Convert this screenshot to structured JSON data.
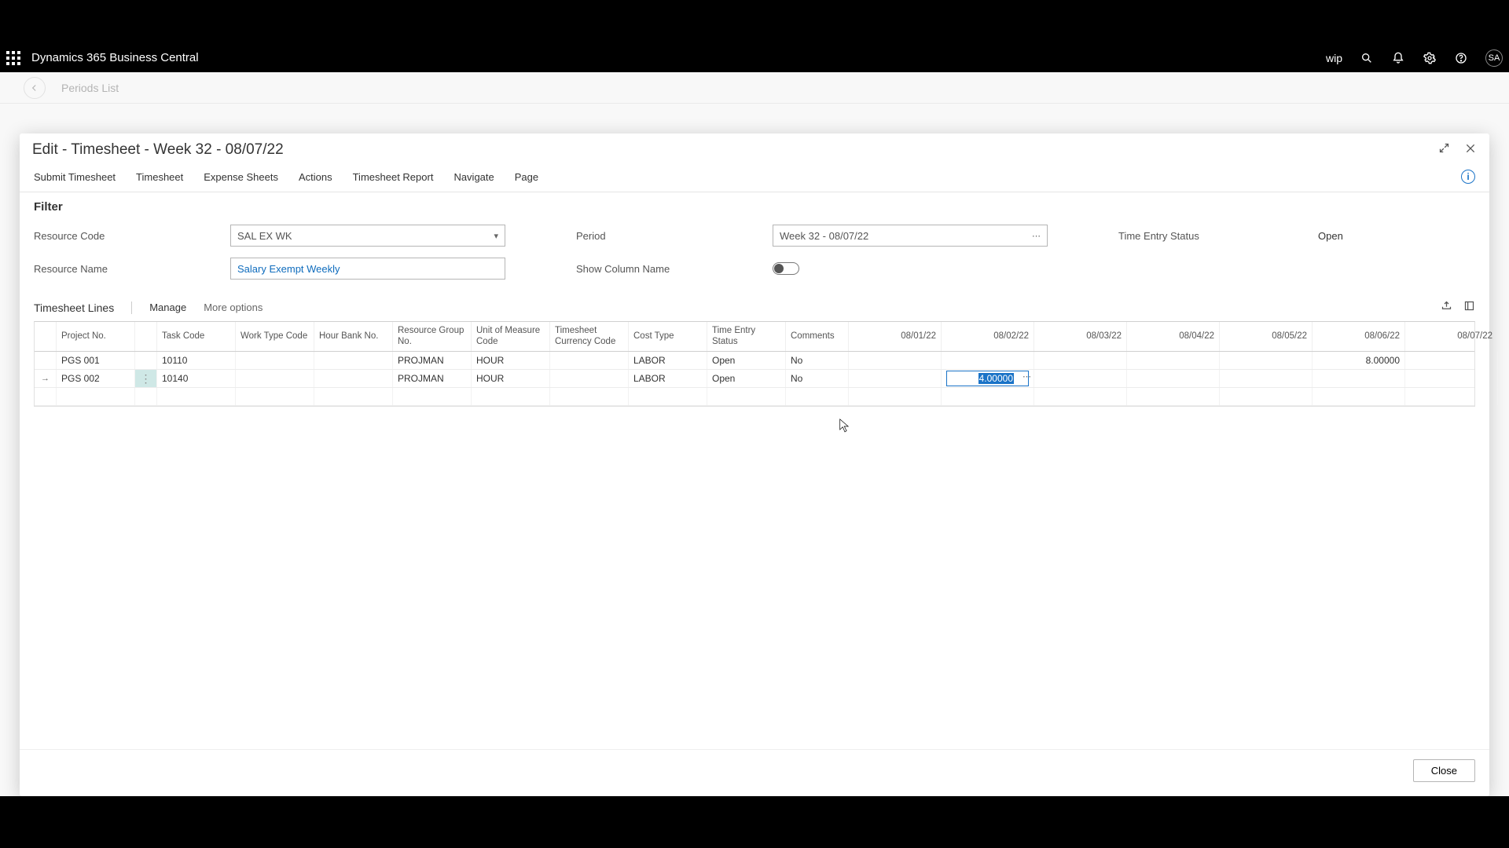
{
  "app": {
    "title": "Dynamics 365 Business Central",
    "env": "wip",
    "user_initials": "SA"
  },
  "bg": {
    "breadcrumb": "Periods List"
  },
  "modal": {
    "title": "Edit - Timesheet - Week 32 - 08/07/22",
    "toolbar": {
      "submit": "Submit Timesheet",
      "timesheet": "Timesheet",
      "expense": "Expense Sheets",
      "actions": "Actions",
      "report": "Timesheet Report",
      "navigate": "Navigate",
      "page": "Page"
    },
    "filter": {
      "title": "Filter",
      "resource_code_label": "Resource Code",
      "resource_code_value": "SAL EX WK",
      "resource_name_label": "Resource Name",
      "resource_name_value": "Salary Exempt Weekly",
      "period_label": "Period",
      "period_value": "Week 32 - 08/07/22",
      "show_col_label": "Show Column Name",
      "status_label": "Time Entry Status",
      "status_value": "Open"
    },
    "lines": {
      "title": "Timesheet Lines",
      "manage": "Manage",
      "more": "More options"
    },
    "columns": {
      "project": "Project No.",
      "task": "Task Code",
      "worktype": "Work Type Code",
      "hourbank": "Hour Bank No.",
      "resgroup": "Resource Group No.",
      "uom": "Unit of Measure Code",
      "curr": "Timesheet Currency Code",
      "costtype": "Cost Type",
      "tes": "Time Entry Status",
      "comments": "Comments",
      "d1": "08/01/22",
      "d2": "08/02/22",
      "d3": "08/03/22",
      "d4": "08/04/22",
      "d5": "08/05/22",
      "d6": "08/06/22",
      "d7": "08/07/22"
    },
    "rows": [
      {
        "project": "PGS 001",
        "task": "10110",
        "worktype": "",
        "hourbank": "",
        "resgroup": "PROJMAN",
        "uom": "HOUR",
        "curr": "",
        "costtype": "LABOR",
        "tes": "Open",
        "comments": "No",
        "d1": "",
        "d2": "",
        "d3": "",
        "d4": "",
        "d5": "",
        "d6": "8.00000",
        "d7": ""
      },
      {
        "project": "PGS 002",
        "task": "10140",
        "worktype": "",
        "hourbank": "",
        "resgroup": "PROJMAN",
        "uom": "HOUR",
        "curr": "",
        "costtype": "LABOR",
        "tes": "Open",
        "comments": "No",
        "d1": "",
        "d2_editing": "4.00000",
        "d3": "",
        "d4": "",
        "d5": "",
        "d6": "",
        "d7": ""
      }
    ],
    "close": "Close"
  }
}
